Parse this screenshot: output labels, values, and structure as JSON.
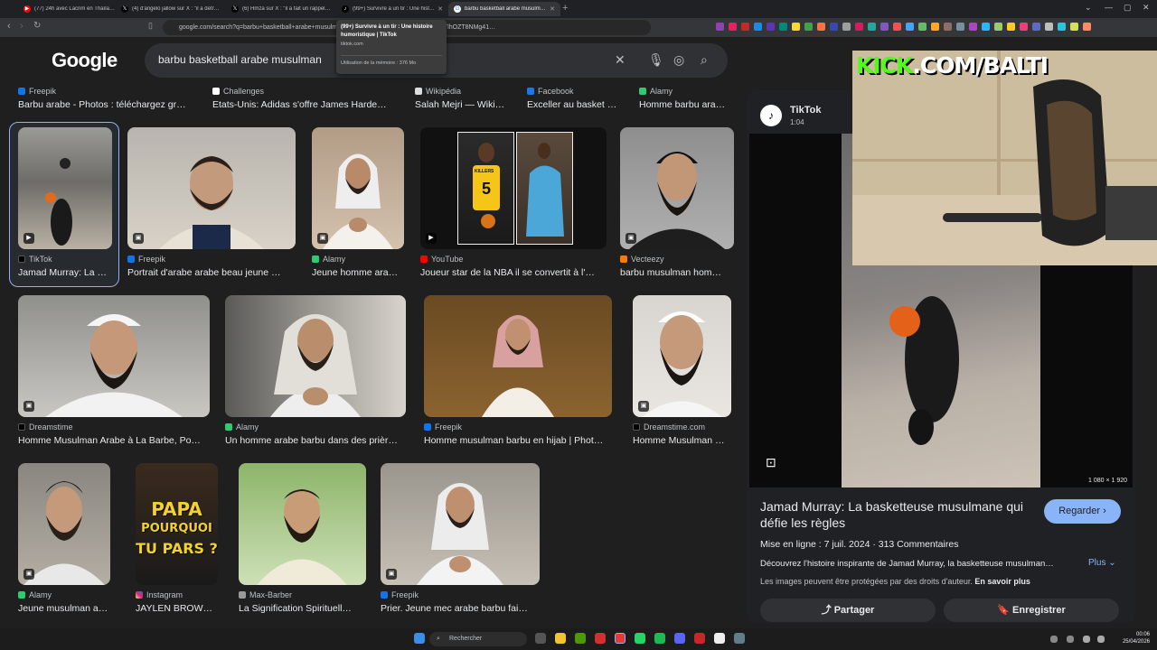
{
  "tabs": [
    {
      "title": "(77) 24h avec Lacrim en Thaïlande w…"
    },
    {
      "title": "(4) d'angelo jallow sur X : \"il a détruit…"
    },
    {
      "title": "(6) Hmza sur X : \"il a fait un rappel a…"
    },
    {
      "title": "(99+) Survivre à un tir : Une histo…"
    },
    {
      "title": "barbu basketball arabe musulm…"
    }
  ],
  "tooltip": {
    "title": "(99+) Survivre à un tir : Une histoire humoristique | TikTok",
    "url": "tiktok.com",
    "memory": "Utilisation de la mémoire : 376 Mo"
  },
  "address": {
    "url": "google.com/search?q=barbu+basketball+arabe+musulman…",
    "url_tail": "CAMSVhoyKh8tLTVRTHdibi9NTlhOZT8NMg41…"
  },
  "google": {
    "logo": "Google",
    "query": "barbu basketball arabe musulman"
  },
  "top_sources": [
    {
      "source": "Freepik",
      "title": "Barbu arabe - Photos : téléchargez gr…"
    },
    {
      "source": "Challenges",
      "title": "Etats-Unis: Adidas s'offre James Harde…"
    },
    {
      "source": "Wikipédia",
      "title": "Salah Mejri — Wiki…"
    },
    {
      "source": "Facebook",
      "title": "Exceller au basket …"
    },
    {
      "source": "Alamy",
      "title": "Homme barbu ara…"
    }
  ],
  "results": [
    {
      "source": "TikTok",
      "title": "Jamad Murray: La …"
    },
    {
      "source": "Freepik",
      "title": "Portrait d'arabe arabe beau jeune …"
    },
    {
      "source": "Alamy",
      "title": "Jeune homme ara…"
    },
    {
      "source": "YouTube",
      "title": "Joueur star de la NBA il se convertit à l'…"
    },
    {
      "source": "Vecteezy",
      "title": "barbu musulman hom…"
    },
    {
      "source": "Dreamstime",
      "title": "Homme Musulman Arabe à La Barbe, Po…"
    },
    {
      "source": "Alamy",
      "title": "Un homme arabe barbu dans des prièr…"
    },
    {
      "source": "Freepik",
      "title": "Homme musulman barbu en hijab | Phot…"
    },
    {
      "source": "Dreamstime.com",
      "title": "Homme Musulman …"
    },
    {
      "source": "Alamy",
      "title": "Jeune musulman a…"
    },
    {
      "source": "Instagram",
      "title": "JAYLEN BROWN (…"
    },
    {
      "source": "Max-Barber",
      "title": "La Signification Spirituell…"
    },
    {
      "source": "Freepik",
      "title": "Prier. Jeune mec arabe barbu fai…"
    }
  ],
  "image_text": {
    "papa_line1": "PAPA",
    "papa_line2": "POURQUOI",
    "papa_line3": "TU PARS ?",
    "jersey": "KILLERS"
  },
  "panel": {
    "source": "TikTok",
    "duration": "1:04",
    "dimensions": "1 080 × 1 920",
    "title": "Jamad Murray: La basketteuse musulmane qui défie les règles",
    "cta": "Regarder",
    "date_line": "Mise en ligne : 7 juil. 2024 · 313 Commentaires",
    "description": "Découvrez l'histoire inspirante de Jamad Murray, la basketteuse musulman…",
    "more": "Plus",
    "copyright": "Les images peuvent être protégées par des droits d'auteur.",
    "copyright_link": "En savoir plus",
    "share": "Partager",
    "save": "Enregistrer"
  },
  "overlay": {
    "kick": "KICK",
    "kick_rest": ".COM/BALTI"
  },
  "taskbar": {
    "search": "Rechercher",
    "time": "00:06",
    "date": "25/04/2026"
  },
  "colors": {
    "accent": "#8ab4f8",
    "kick_green": "#53fc18",
    "page_bg": "#1f1f1f"
  }
}
